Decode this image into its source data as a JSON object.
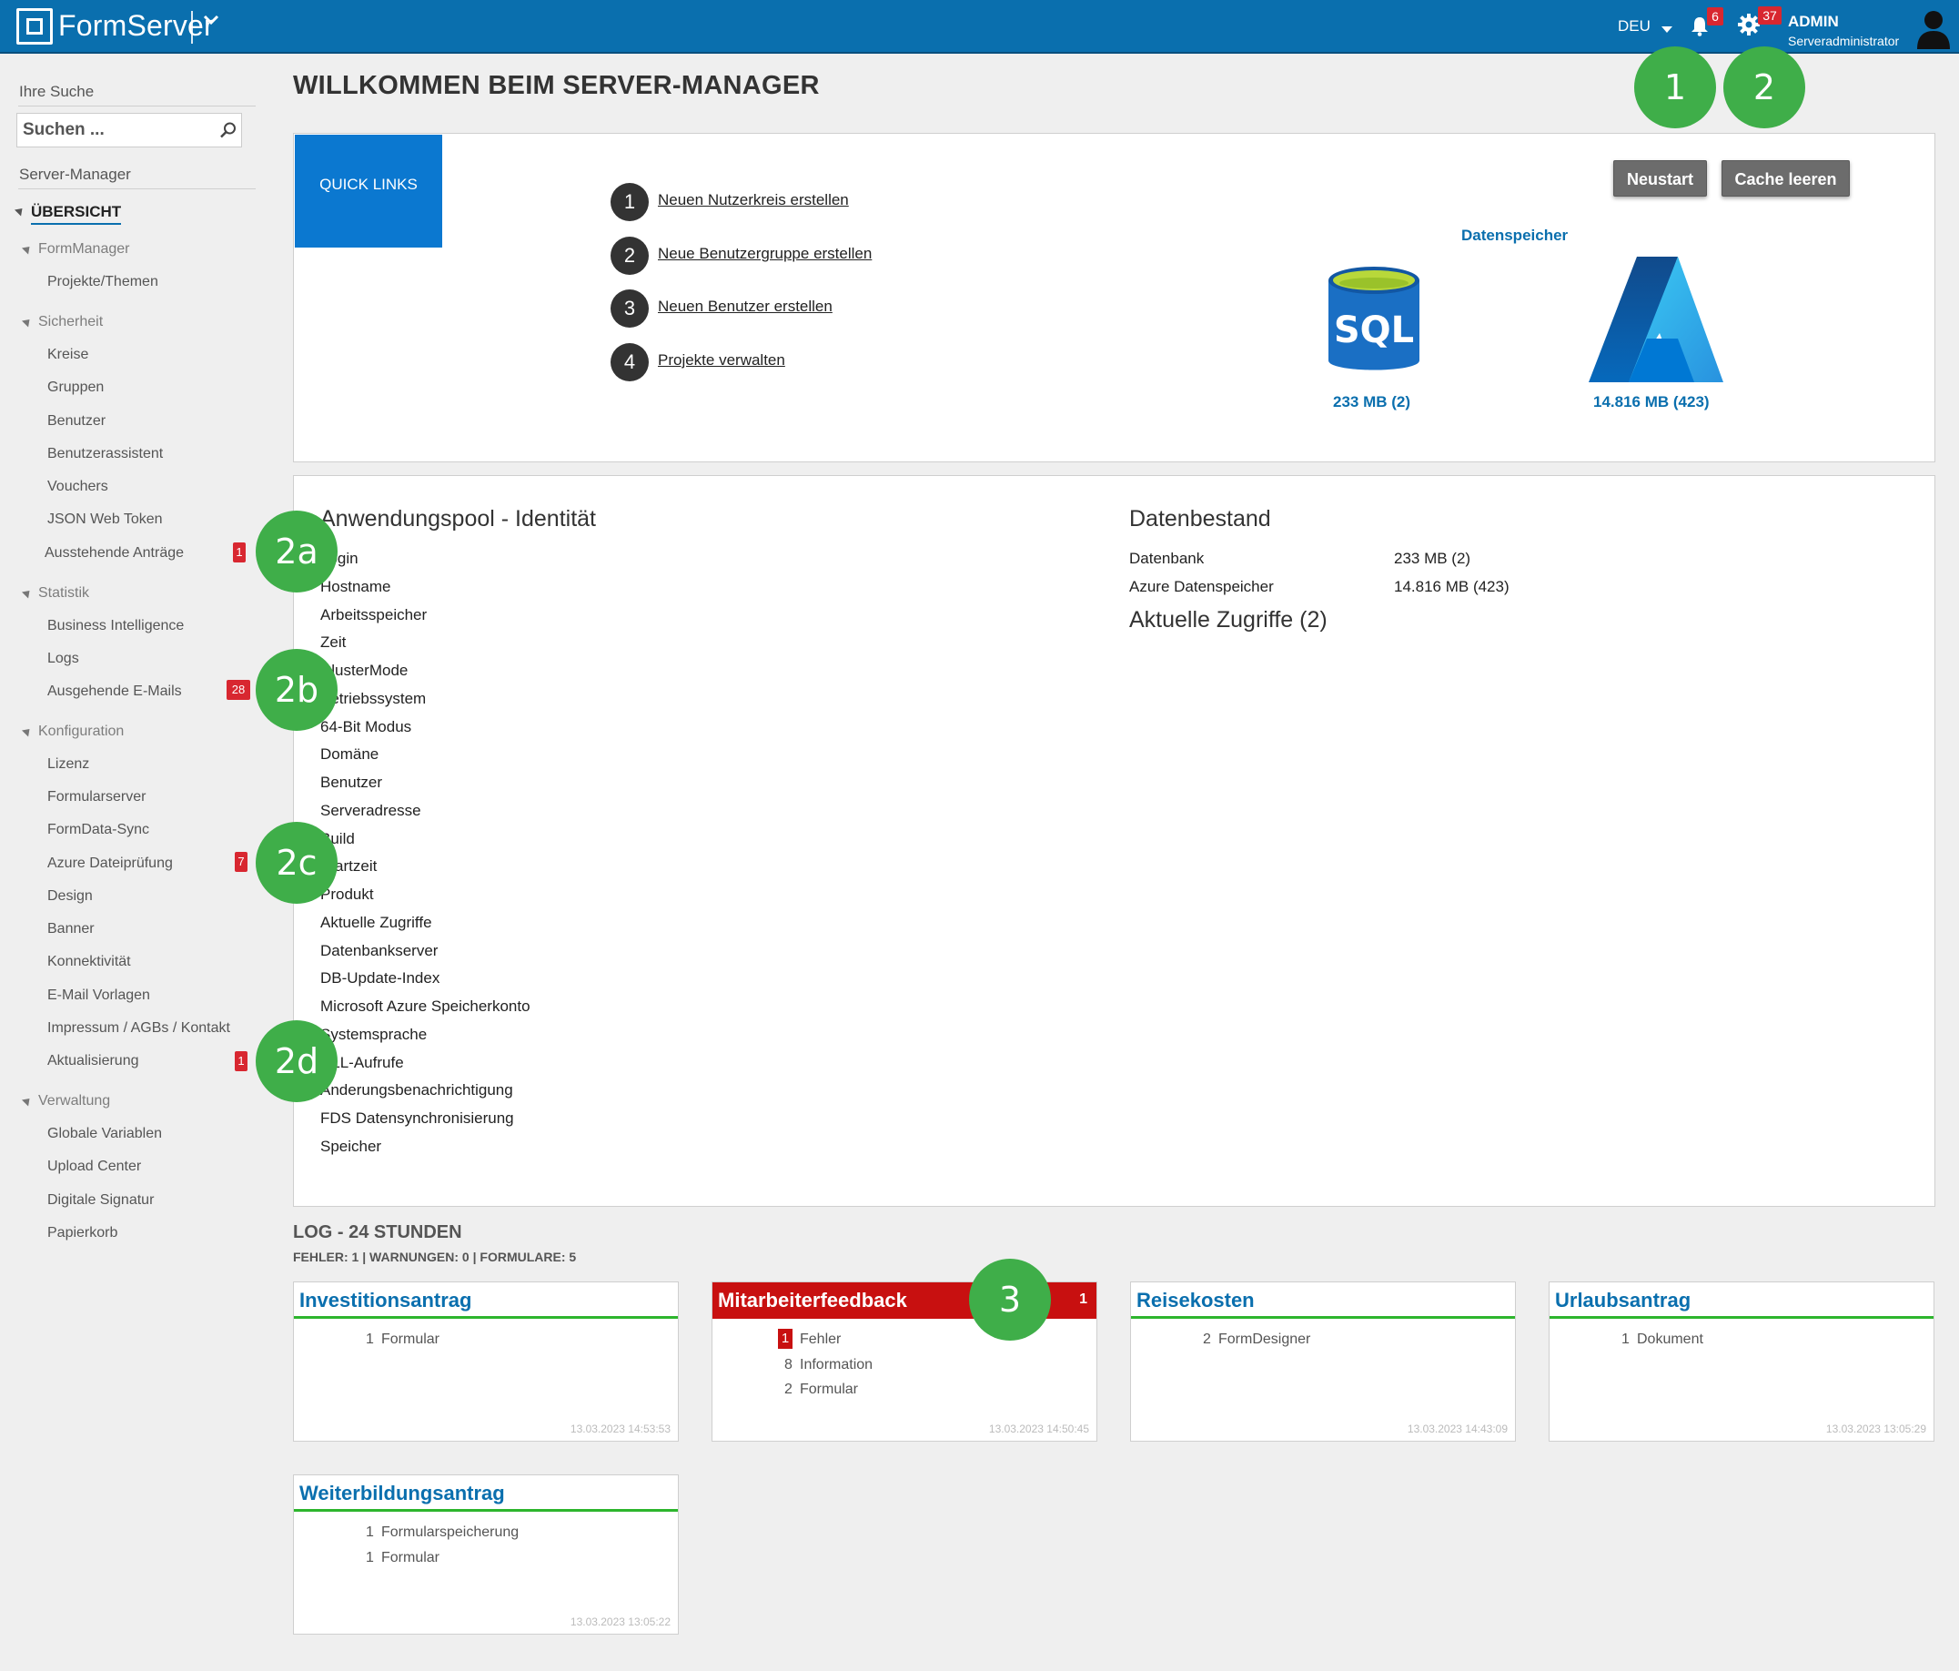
{
  "header": {
    "logo_text": "FormServer",
    "language": "DEU",
    "notifications_count": "6",
    "settings_count": "37",
    "user_name": "ADMIN",
    "user_role": "Serveradministrator"
  },
  "sidebar": {
    "search_label": "Ihre Suche",
    "search_placeholder": "Suchen ...",
    "section_title": "Server-Manager",
    "overview": "ÜBERSICHT",
    "groups": [
      {
        "label": "FormManager",
        "items": [
          {
            "label": "Projekte/Themen"
          }
        ]
      },
      {
        "label": "Sicherheit",
        "items": [
          {
            "label": "Kreise"
          },
          {
            "label": "Gruppen"
          },
          {
            "label": "Benutzer"
          },
          {
            "label": "Benutzerassistent"
          },
          {
            "label": "Vouchers"
          },
          {
            "label": "JSON Web Token"
          },
          {
            "label": "Ausstehende Anträge",
            "badge": "1"
          }
        ]
      },
      {
        "label": "Statistik",
        "items": [
          {
            "label": "Business Intelligence"
          },
          {
            "label": "Logs"
          },
          {
            "label": "Ausgehende E-Mails",
            "badge": "28"
          }
        ]
      },
      {
        "label": "Konfiguration",
        "items": [
          {
            "label": "Lizenz"
          },
          {
            "label": "Formularserver"
          },
          {
            "label": "FormData-Sync"
          },
          {
            "label": "Azure Dateiprüfung",
            "badge": "7"
          },
          {
            "label": "Design"
          },
          {
            "label": "Banner"
          },
          {
            "label": "Konnektivität"
          },
          {
            "label": "E-Mail Vorlagen"
          },
          {
            "label": "Impressum / AGBs / Kontakt"
          },
          {
            "label": "Aktualisierung",
            "badge": "1"
          }
        ]
      },
      {
        "label": "Verwaltung",
        "items": [
          {
            "label": "Globale Variablen"
          },
          {
            "label": "Upload Center"
          },
          {
            "label": "Digitale Signatur"
          },
          {
            "label": "Papierkorb"
          }
        ]
      }
    ]
  },
  "callouts": [
    "1",
    "2",
    "2a",
    "2b",
    "2c",
    "2d",
    "3"
  ],
  "main": {
    "title": "WILLKOMMEN BEIM SERVER-MANAGER",
    "quick_links_tile": "QUICK LINKS",
    "quick_links": [
      {
        "num": "1",
        "label": "Neuen Nutzerkreis erstellen"
      },
      {
        "num": "2",
        "label": "Neue Benutzergruppe erstellen"
      },
      {
        "num": "3",
        "label": "Neuen Benutzer erstellen"
      },
      {
        "num": "4",
        "label": "Projekte verwalten"
      }
    ],
    "restart_label": "Neustart",
    "clear_cache_label": "Cache leeren",
    "storage_title": "Datenspeicher",
    "sql_icon_text": "SQL",
    "sql_value": "233 MB (2)",
    "azure_value": "14.816 MB (423)"
  },
  "identity": {
    "title": "Anwendungspool - Identität",
    "fields": [
      "Login",
      "Hostname",
      "Arbeitsspeicher",
      "Zeit",
      "ClusterMode",
      "Betriebssystem",
      "64-Bit Modus",
      "Domäne",
      "Benutzer",
      "Serveradresse",
      "Build",
      "Startzeit",
      "Produkt",
      "Aktuelle Zugriffe",
      "Datenbankserver",
      "DB-Update-Index",
      "Microsoft Azure Speicherkonto",
      "Systemsprache",
      "DLL-Aufrufe",
      "Änderungsbenachrichtigung",
      "FDS Datensynchronisierung",
      "Speicher"
    ]
  },
  "datenbestand": {
    "title": "Datenbestand",
    "rows": [
      {
        "label": "Datenbank",
        "value": "233 MB (2)"
      },
      {
        "label": "Azure Datenspeicher",
        "value": "14.816 MB (423)"
      }
    ],
    "access_title": "Aktuelle Zugriffe (2)"
  },
  "log": {
    "title": "LOG - 24 STUNDEN",
    "summary": "FEHLER: 1 | WARNUNGEN: 0 | FORMULARE: 5",
    "cards": [
      {
        "title": "Investitionsantrag",
        "lines": [
          {
            "count": "1",
            "label": "Formular"
          }
        ],
        "timestamp": "13.03.2023 14:53:53"
      },
      {
        "title": "Mitarbeiterfeedback",
        "error_count": "1",
        "lines": [
          {
            "count": "1",
            "label": "Fehler"
          },
          {
            "count": "8",
            "label": "Information"
          },
          {
            "count": "2",
            "label": "Formular"
          }
        ],
        "timestamp": "13.03.2023 14:50:45"
      },
      {
        "title": "Reisekosten",
        "lines": [
          {
            "count": "2",
            "label": "FormDesigner"
          }
        ],
        "timestamp": "13.03.2023 14:43:09"
      },
      {
        "title": "Urlaubsantrag",
        "lines": [
          {
            "count": "1",
            "label": "Dokument"
          }
        ],
        "timestamp": "13.03.2023 13:05:29"
      },
      {
        "title": "Weiterbildungsantrag",
        "lines": [
          {
            "count": "1",
            "label": "Formularspeicherung"
          },
          {
            "count": "1",
            "label": "Formular"
          }
        ],
        "timestamp": "13.03.2023 13:05:22"
      }
    ]
  },
  "colors": {
    "header_bg": "#0a6fae",
    "accent_blue": "#0b78d0",
    "callout_green": "#3fae49",
    "badge_red": "#d82730",
    "error_red": "#c81010",
    "card_underline": "#2db52d"
  }
}
